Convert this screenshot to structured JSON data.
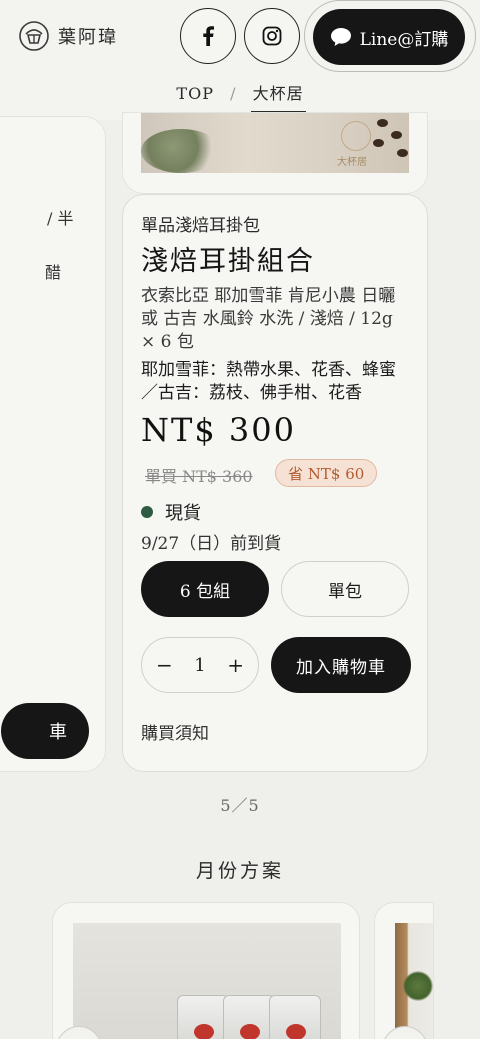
{
  "header": {
    "brand": "葉阿瑋",
    "line_button_label": "Line@訂購"
  },
  "breadcrumb": {
    "home": "TOP",
    "separator": "/",
    "current": "大杯居"
  },
  "left_card": {
    "fragment_1": "/ 半",
    "fragment_2": "醋",
    "cart_fragment": "車"
  },
  "product": {
    "category": "單品淺焙耳掛包",
    "title": "淺焙耳掛組合",
    "description": "衣索比亞 耶加雪菲 肯尼小農 日曬 或 古吉 水風鈴 水洗 / 淺焙 / 12g × 6 包",
    "notes": "耶加雪菲：熱帶水果、花香、蜂蜜／古吉：荔枝、佛手柑、花香",
    "price": "NT$ 300",
    "original_price": "單買 NT$ 360",
    "save_badge": "省 NT$ 60",
    "stock_status": "現貨",
    "stock_color": "#2f5a44",
    "shipping": "9/27（日）前到貨",
    "options": [
      "6 包組",
      "單包"
    ],
    "quantity": "1",
    "qty_minus": "−",
    "qty_plus": "+",
    "add_to_cart": "加入購物車",
    "purchase_notice": "購買須知"
  },
  "pager": "5／5",
  "monthly_section_title": "月份方案",
  "image_stamp_text": "大杯居"
}
